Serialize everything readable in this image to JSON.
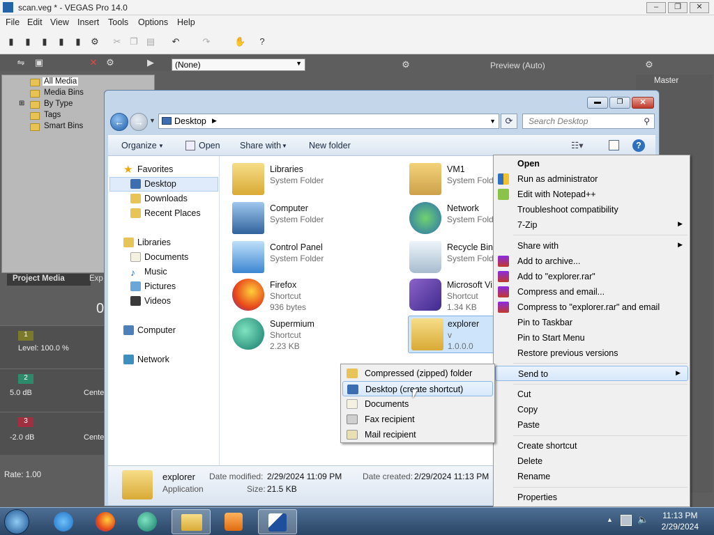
{
  "vegas": {
    "title": "scan.veg * - VEGAS Pro 14.0",
    "menu": [
      "File",
      "Edit",
      "View",
      "Insert",
      "Tools",
      "Options",
      "Help"
    ],
    "preset": "(None)",
    "preview": "Preview (Auto)",
    "master": "Master",
    "tree": [
      "All Media",
      "Media Bins",
      "By Type",
      "Tags",
      "Smart Bins"
    ],
    "project_media_tab": "Project Media",
    "explorer_tab": "Exp",
    "level": "Level: 100.0 %",
    "track2_db": "5.0 dB",
    "track3_db": "-2.0 dB",
    "center": "Cente",
    "rate": "Rate: 1.00",
    "timecode_partial": "0",
    "track_numbers": [
      "1",
      "2",
      "3"
    ]
  },
  "explorer": {
    "address": "Desktop",
    "search_placeholder": "Search Desktop",
    "commands": {
      "organize": "Organize",
      "open": "Open",
      "share_with": "Share with",
      "new_folder": "New folder"
    },
    "nav": {
      "favorites": "Favorites",
      "desktop": "Desktop",
      "downloads": "Downloads",
      "recent": "Recent Places",
      "libraries": "Libraries",
      "documents": "Documents",
      "music": "Music",
      "pictures": "Pictures",
      "videos": "Videos",
      "computer": "Computer",
      "network": "Network"
    },
    "items": [
      {
        "name": "Libraries",
        "sub": "System Folder"
      },
      {
        "name": "VM1",
        "sub": "System Folder"
      },
      {
        "name": "Computer",
        "sub": "System Folder"
      },
      {
        "name": "Network",
        "sub": "System Folder"
      },
      {
        "name": "Control Panel",
        "sub": "System Folder"
      },
      {
        "name": "Recycle Bin",
        "sub": "System Folder"
      },
      {
        "name": "Firefox",
        "sub": "Shortcut",
        "sub2": "936 bytes"
      },
      {
        "name": "Microsoft Vi",
        "sub": "Shortcut",
        "sub2": "1.34 KB"
      },
      {
        "name": "Supermium",
        "sub": "Shortcut",
        "sub2": "2.23 KB"
      },
      {
        "name": "explorer",
        "sub": "v",
        "sub2": "1.0.0.0"
      }
    ],
    "details": {
      "name": "explorer",
      "type": "Application",
      "modified_label": "Date modified:",
      "modified": "2/29/2024 11:09 PM",
      "created_label": "Date created:",
      "created": "2/29/2024 11:13 PM",
      "size_label": "Size:",
      "size": "21.5 KB"
    }
  },
  "context_menu": {
    "open": "Open",
    "run_admin": "Run as administrator",
    "notepad": "Edit with Notepad++",
    "troubleshoot": "Troubleshoot compatibility",
    "zip7": "7-Zip",
    "share_with": "Share with",
    "add_archive": "Add to archive...",
    "add_rar": "Add to \"explorer.rar\"",
    "compress_email": "Compress and email...",
    "compress_rar_email": "Compress to \"explorer.rar\" and email",
    "pin_taskbar": "Pin to Taskbar",
    "pin_start": "Pin to Start Menu",
    "restore": "Restore previous versions",
    "send_to": "Send to",
    "cut": "Cut",
    "copy": "Copy",
    "paste": "Paste",
    "create_shortcut": "Create shortcut",
    "delete": "Delete",
    "rename": "Rename",
    "properties": "Properties"
  },
  "send_to_menu": [
    "Compressed (zipped) folder",
    "Desktop (create shortcut)",
    "Documents",
    "Fax recipient",
    "Mail recipient"
  ],
  "taskbar": {
    "time": "11:13 PM",
    "date": "2/29/2024"
  },
  "colors": {
    "accent": "#1f5ea8",
    "highlight": "#d7e8fb",
    "taskbar": "#2a4566"
  }
}
